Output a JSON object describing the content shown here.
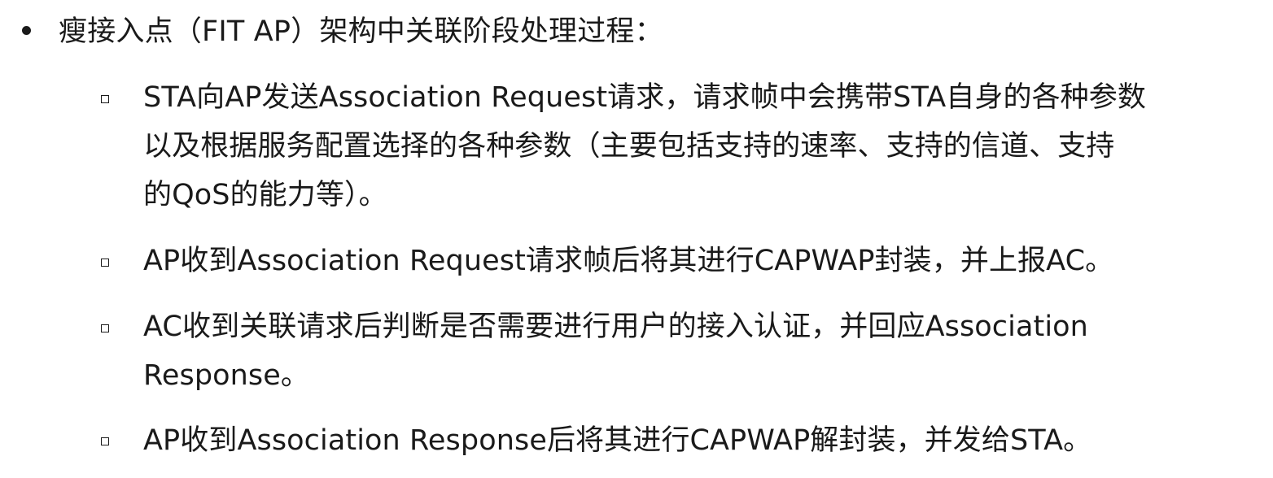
{
  "heading": "瘦接入点（FIT AP）架构中关联阶段处理过程：",
  "items": [
    {
      "lines": [
        "STA向AP发送Association Request请求，请求帧中会携带STA自身的各种参数",
        "以及根据服务配置选择的各种参数（主要包括支持的速率、支持的信道、支持",
        "的QoS的能力等）。"
      ]
    },
    {
      "lines": [
        "AP收到Association Request请求帧后将其进行CAPWAP封装，并上报AC。"
      ]
    },
    {
      "lines": [
        "AC收到关联请求后判断是否需要进行用户的接入认证，并回应Association",
        "Response。"
      ]
    },
    {
      "lines": [
        "AP收到Association Response后将其进行CAPWAP解封装，并发给STA。"
      ]
    }
  ]
}
